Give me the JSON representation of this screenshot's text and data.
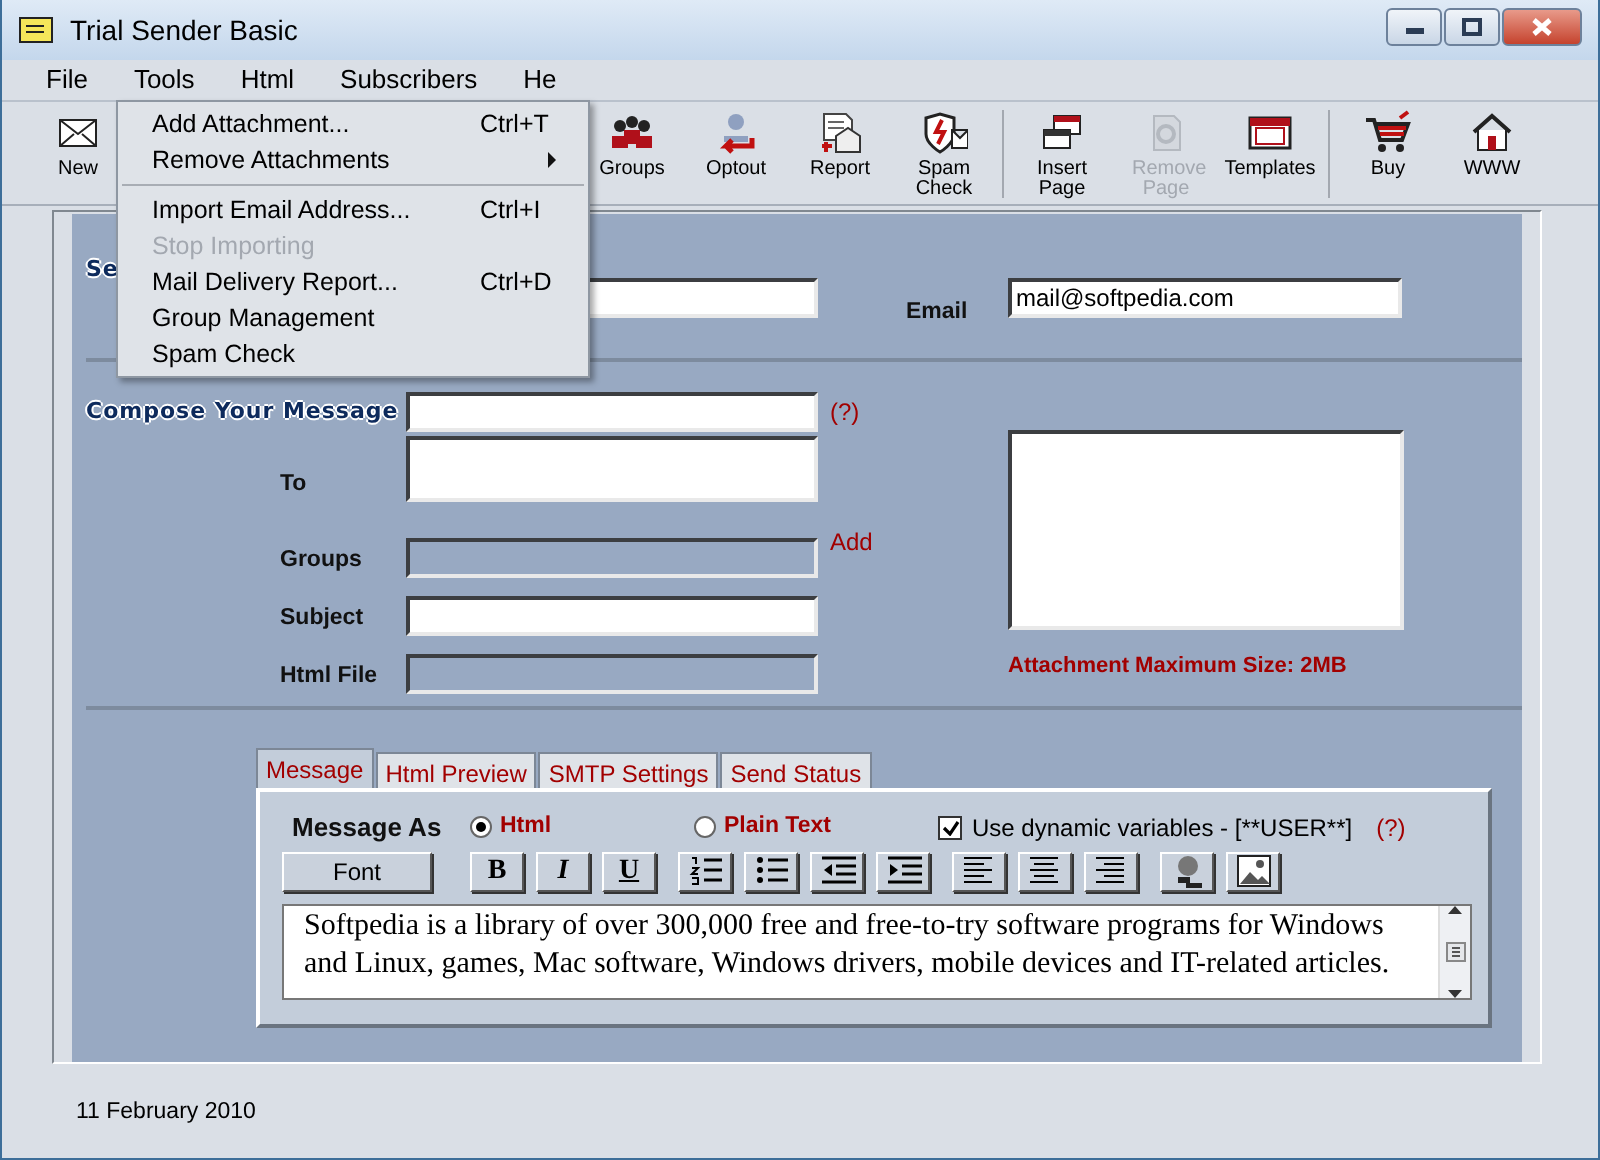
{
  "window": {
    "title": "Trial Sender Basic"
  },
  "menu": [
    {
      "label": "File"
    },
    {
      "label": "Tools"
    },
    {
      "label": "Html"
    },
    {
      "label": "Subscribers"
    },
    {
      "label": "He"
    }
  ],
  "dropdown": [
    {
      "kind": "item",
      "label": "Add Attachment...",
      "shortcut": "Ctrl+T",
      "disabled": false,
      "submenu": false
    },
    {
      "kind": "item",
      "label": "Remove Attachments",
      "disabled": false,
      "submenu": true
    },
    {
      "kind": "separator"
    },
    {
      "kind": "item",
      "label": "Import Email Address...",
      "shortcut": "Ctrl+I",
      "disabled": false,
      "submenu": false
    },
    {
      "kind": "item",
      "label": "Stop Importing",
      "disabled": true,
      "submenu": false
    },
    {
      "kind": "item",
      "label": "Mail Delivery Report...",
      "shortcut": "Ctrl+D",
      "disabled": false,
      "submenu": false
    },
    {
      "kind": "item",
      "label": "Group Management",
      "disabled": false,
      "submenu": false
    },
    {
      "kind": "item",
      "label": "Spam Check",
      "disabled": false,
      "submenu": false
    }
  ],
  "toolbar": [
    {
      "kind": "new",
      "label": "New",
      "disabled": false
    },
    {
      "kind": "hidden"
    },
    {
      "kind": "groups",
      "label": "Groups",
      "disabled": false
    },
    {
      "kind": "optout",
      "label": "Optout",
      "disabled": false
    },
    {
      "kind": "report",
      "label": "Report",
      "disabled": false
    },
    {
      "kind": "spam",
      "label": "Spam Check",
      "disabled": false
    },
    {
      "kind": "separator"
    },
    {
      "kind": "insert",
      "label": "Insert Page",
      "disabled": false
    },
    {
      "kind": "remove",
      "label": "Remove Page",
      "disabled": true
    },
    {
      "kind": "templates",
      "label": "Templates",
      "disabled": false
    },
    {
      "kind": "separator"
    },
    {
      "kind": "buy",
      "label": "Buy",
      "disabled": false
    },
    {
      "kind": "www",
      "label": "WWW",
      "disabled": false
    }
  ],
  "sender": {
    "label": "Se",
    "email_label": "Email",
    "email_value": "mail@softpedia.com"
  },
  "compose": {
    "title": "Compose Your Message",
    "help": "(?)",
    "fields": [
      {
        "label": "To",
        "kind": "multiline",
        "disabled": false
      },
      {
        "label": "Groups",
        "kind": "line",
        "disabled": true,
        "action": "Add"
      },
      {
        "label": "Subject",
        "kind": "line",
        "disabled": false
      },
      {
        "label": "Html File",
        "kind": "line",
        "disabled": true
      }
    ],
    "attachment_note": "Attachment Maximum Size: 2MB"
  },
  "tabs": [
    {
      "label": "Message",
      "selected": true
    },
    {
      "label": "Html Preview",
      "selected": false
    },
    {
      "label": "SMTP Settings",
      "selected": false
    },
    {
      "label": "Send Status",
      "selected": false
    }
  ],
  "message_as": {
    "label": "Message As",
    "options": [
      {
        "label": "Html",
        "selected": true
      },
      {
        "label": "Plain Text",
        "selected": false
      }
    ],
    "dynamic": {
      "label": "Use dynamic variables - [**USER**]",
      "checked": true
    },
    "help": "(?)"
  },
  "format_bar": {
    "font_button": "Font",
    "tools": [
      {
        "kind": "bold",
        "text": "B"
      },
      {
        "kind": "italic",
        "text": "I"
      },
      {
        "kind": "underline",
        "text": "U"
      },
      {
        "kind": "separator"
      },
      {
        "kind": "ordered-list"
      },
      {
        "kind": "bullet-list"
      },
      {
        "kind": "outdent"
      },
      {
        "kind": "indent"
      },
      {
        "kind": "separator"
      },
      {
        "kind": "align-left"
      },
      {
        "kind": "align-center"
      },
      {
        "kind": "align-right"
      },
      {
        "kind": "separator"
      },
      {
        "kind": "link"
      },
      {
        "kind": "image"
      }
    ]
  },
  "editor": {
    "lines": [
      "Softpedia is a library of over 300,000 free and free-to-try software programs for Windows",
      "and Linux, games, Mac software, Windows drivers, mobile devices and IT-related articles."
    ]
  },
  "status_bar": {
    "date": "11 February 2010"
  }
}
